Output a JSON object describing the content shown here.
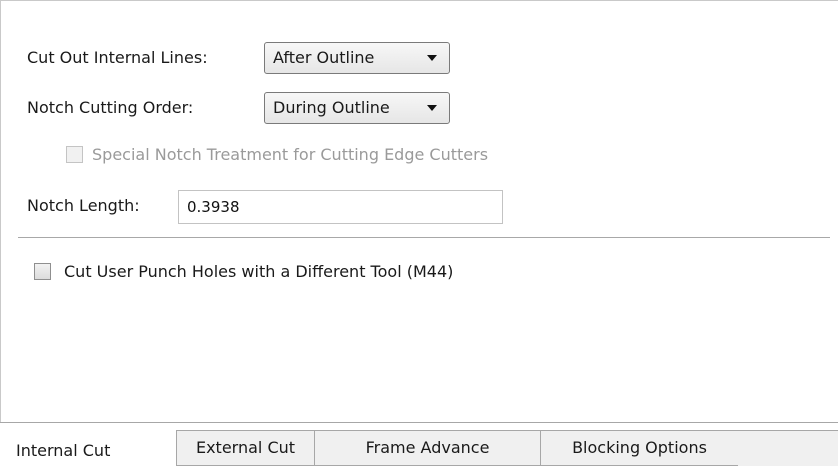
{
  "cut_out_internal_lines": {
    "label": "Cut Out Internal Lines:",
    "value": "After Outline"
  },
  "notch_cutting_order": {
    "label": "Notch Cutting Order:",
    "value": "During Outline"
  },
  "special_notch_treatment": {
    "label": "Special Notch Treatment for Cutting Edge Cutters",
    "checked": false,
    "enabled": false
  },
  "notch_length": {
    "label": "Notch Length:",
    "value": "0.3938"
  },
  "cut_user_punch_holes": {
    "label": "Cut User Punch Holes with a Different Tool (M44)",
    "checked": false
  },
  "tabs": [
    {
      "label": "Internal Cut",
      "active": true
    },
    {
      "label": "External Cut",
      "active": false
    },
    {
      "label": "Frame Advance",
      "active": false
    },
    {
      "label": "Blocking Options",
      "active": false
    }
  ],
  "icons": {
    "dropdown": "chevron-down-icon"
  }
}
